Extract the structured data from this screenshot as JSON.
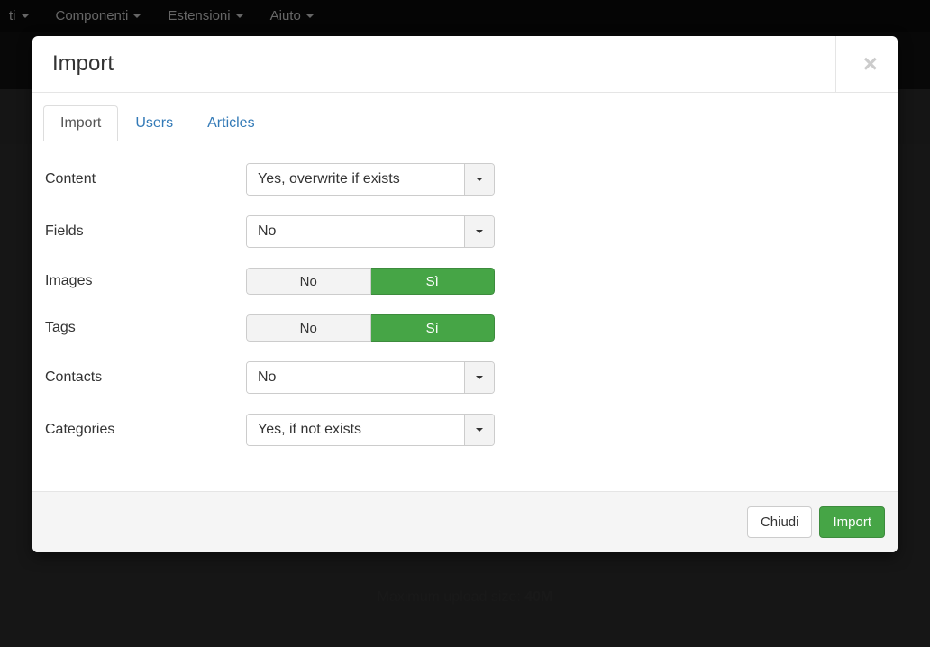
{
  "backdrop": {
    "nav": [
      "ti",
      "Componenti",
      "Estensioni",
      "Aiuto"
    ],
    "upload_label": "Maximum upload size: ",
    "upload_value": "40M"
  },
  "modal": {
    "title": "Import",
    "close_glyph": "×",
    "tabs": [
      {
        "label": "Import",
        "active": true
      },
      {
        "label": "Users",
        "active": false
      },
      {
        "label": "Articles",
        "active": false
      }
    ],
    "fields": {
      "content": {
        "label": "Content",
        "type": "select",
        "value": "Yes, overwrite if exists"
      },
      "fields": {
        "label": "Fields",
        "type": "select",
        "value": "No"
      },
      "images": {
        "label": "Images",
        "type": "toggle",
        "no": "No",
        "yes": "Sì",
        "selected": "yes"
      },
      "tags": {
        "label": "Tags",
        "type": "toggle",
        "no": "No",
        "yes": "Sì",
        "selected": "yes"
      },
      "contacts": {
        "label": "Contacts",
        "type": "select",
        "value": "No"
      },
      "categories": {
        "label": "Categories",
        "type": "select",
        "value": "Yes, if not exists"
      }
    },
    "footer": {
      "close": "Chiudi",
      "import": "Import"
    }
  }
}
